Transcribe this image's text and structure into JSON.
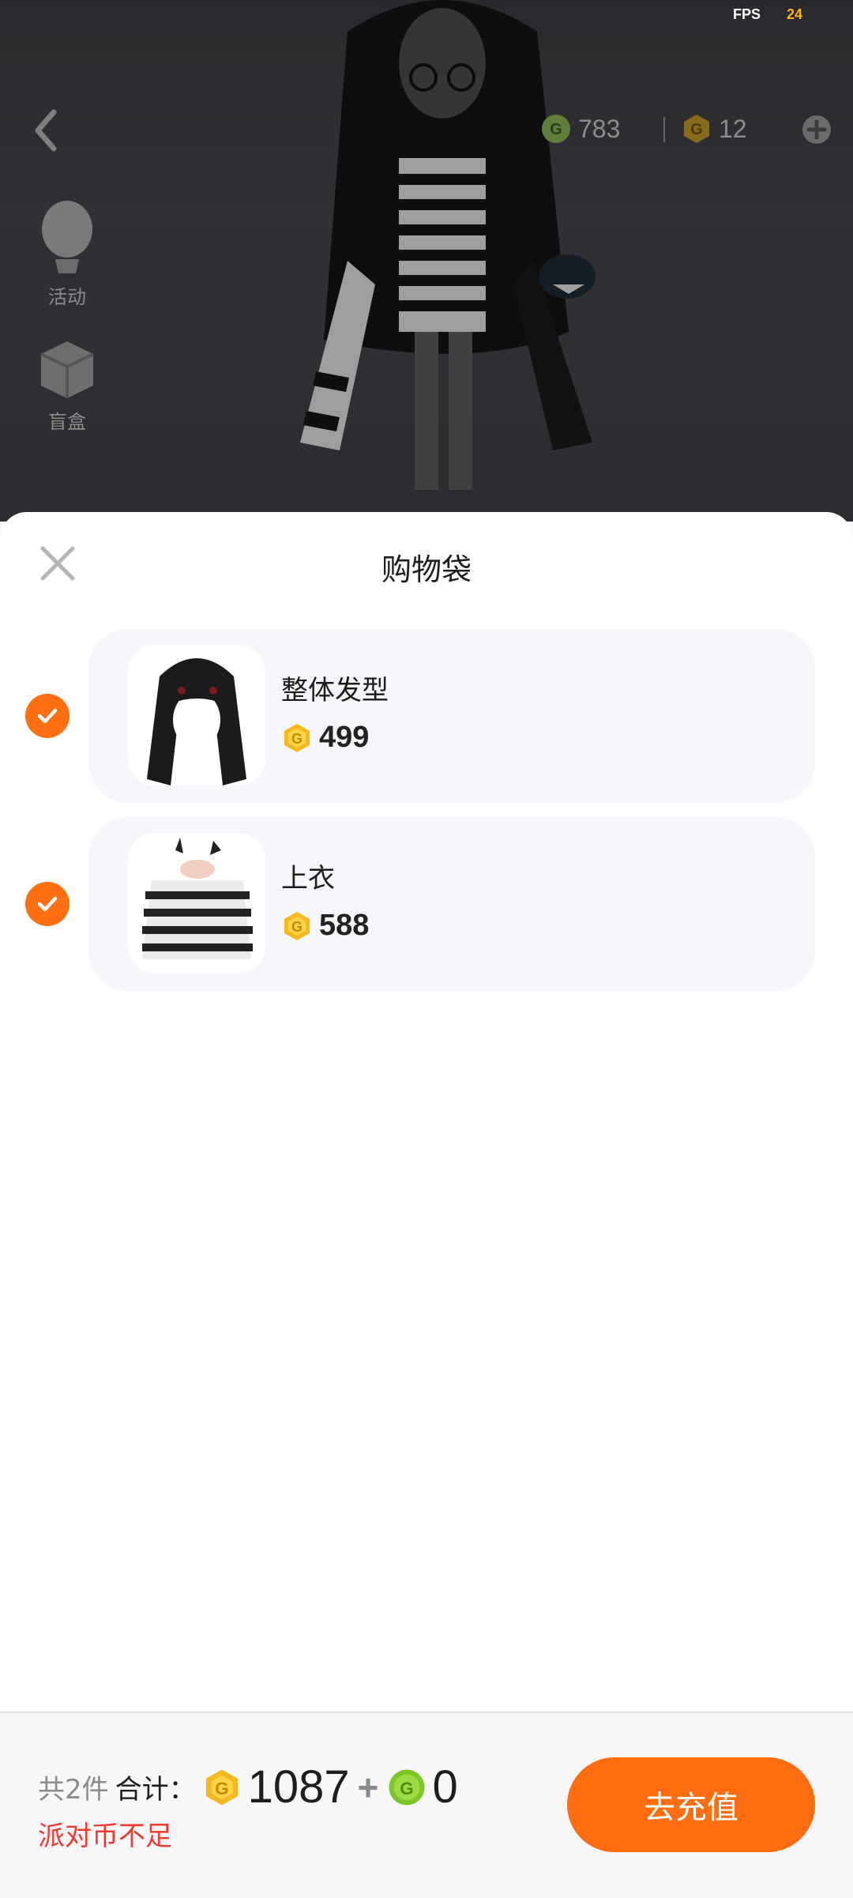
{
  "status": {
    "fps_label": "FPS",
    "fps_value": "24"
  },
  "topbar": {
    "green_coin_balance": "783",
    "gold_coin_balance": "12",
    "back_icon": "chevron-left-icon",
    "add_icon": "plus-circle-icon"
  },
  "side_menu": [
    {
      "label": "活动",
      "icon": "hot-air-balloon-icon"
    },
    {
      "label": "盲盒",
      "icon": "blind-box-icon"
    }
  ],
  "sheet": {
    "title": "购物袋",
    "close_icon": "close-icon",
    "items": [
      {
        "name": "整体发型",
        "price": "499",
        "selected": true,
        "thumb": "hairstyle-thumbnail"
      },
      {
        "name": "上衣",
        "price": "588",
        "selected": true,
        "thumb": "striped-top-thumbnail"
      }
    ]
  },
  "footer": {
    "count_text": "共2件",
    "sum_label": "合计：",
    "gold_total": "1087",
    "plus": "+",
    "green_total": "0",
    "warning": "派对币不足",
    "button_label": "去充值"
  },
  "colors": {
    "accent": "#ff6d10",
    "check": "#ff6f12",
    "warning": "#ee3b2e",
    "gold_coin": "#f6b81c",
    "green_coin": "#7cc52a"
  }
}
